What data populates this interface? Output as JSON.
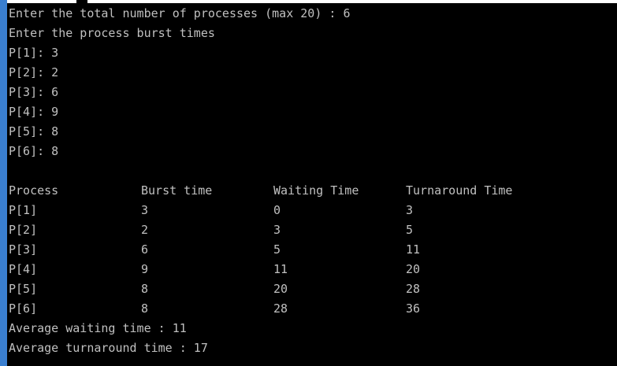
{
  "console": {
    "prompt_count": "Enter the total number of processes (max 20) : 6",
    "prompt_burst": "Enter the process burst times",
    "inputs": [
      "P[1]: 3",
      "P[2]: 2",
      "P[3]: 6",
      "P[4]: 9",
      "P[5]: 8",
      "P[6]: 8"
    ],
    "table": {
      "headers": [
        "Process",
        "Burst time",
        "Waiting Time",
        "Turnaround Time"
      ],
      "rows": [
        [
          "P[1]",
          "3",
          "0",
          "3"
        ],
        [
          "P[2]",
          "2",
          "3",
          "5"
        ],
        [
          "P[3]",
          "6",
          "5",
          "11"
        ],
        [
          "P[4]",
          "9",
          "11",
          "20"
        ],
        [
          "P[5]",
          "8",
          "20",
          "28"
        ],
        [
          "P[6]",
          "8",
          "28",
          "36"
        ]
      ]
    },
    "avg_waiting": "Average waiting time : 11",
    "avg_turnaround": "Average turnaround time : 17"
  },
  "colors": {
    "background": "#000000",
    "text": "#c0c0c0",
    "window_border": "#3a7fd0"
  }
}
